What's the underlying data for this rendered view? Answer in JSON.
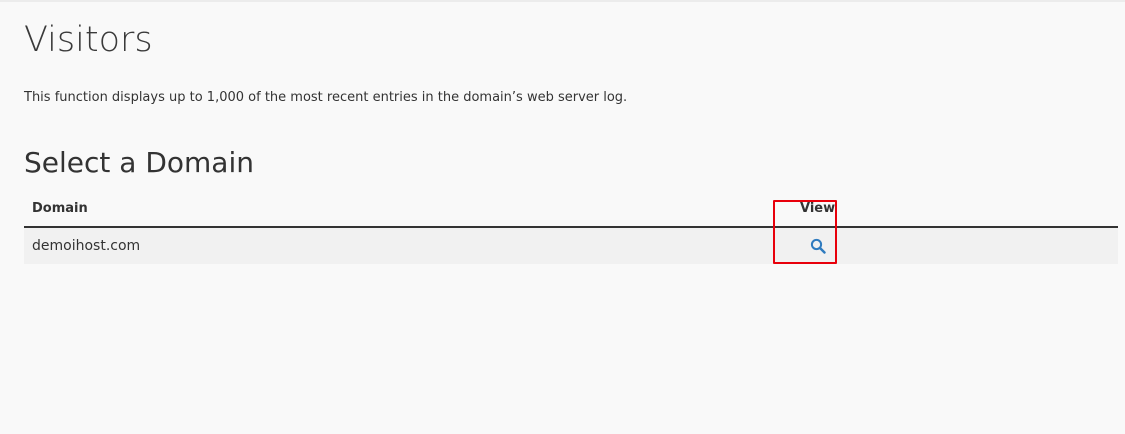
{
  "page": {
    "title": "Visitors",
    "description": "This function displays up to 1,000 of the most recent entries in the domain’s web server log."
  },
  "domain_section": {
    "title": "Select a Domain",
    "columns": {
      "domain": "Domain",
      "view": "View"
    },
    "rows": [
      {
        "domain": "demoihost.com",
        "view_icon": "search-icon"
      }
    ]
  },
  "colors": {
    "accent_icon": "#2f7bbf",
    "highlight_border": "#e8000b",
    "row_background": "#f1f1f1",
    "page_background": "#f9f9f9"
  }
}
